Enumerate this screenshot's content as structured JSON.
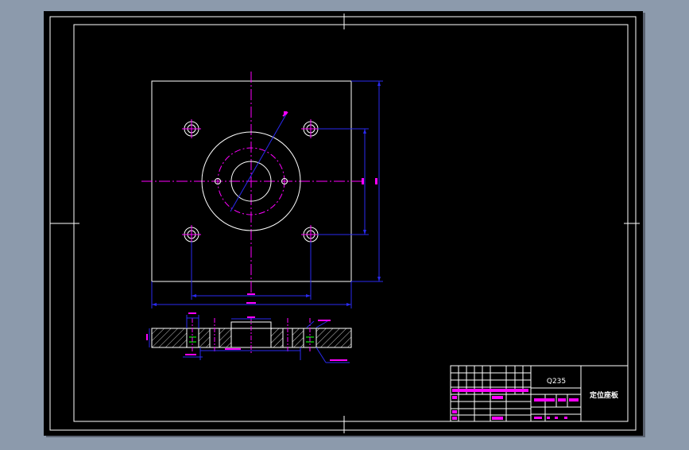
{
  "colors": {
    "app_background": "#8c9aac",
    "viewport_background": "#000000",
    "frame": "#ffffff",
    "dimension": "#2a2af0",
    "centerline": "#ff00ff",
    "annotation": "#ff00ff",
    "hidden": "#00c000",
    "text": "#ffffff"
  },
  "title_block": {
    "material": "Q235",
    "part_name": "定位座板"
  }
}
